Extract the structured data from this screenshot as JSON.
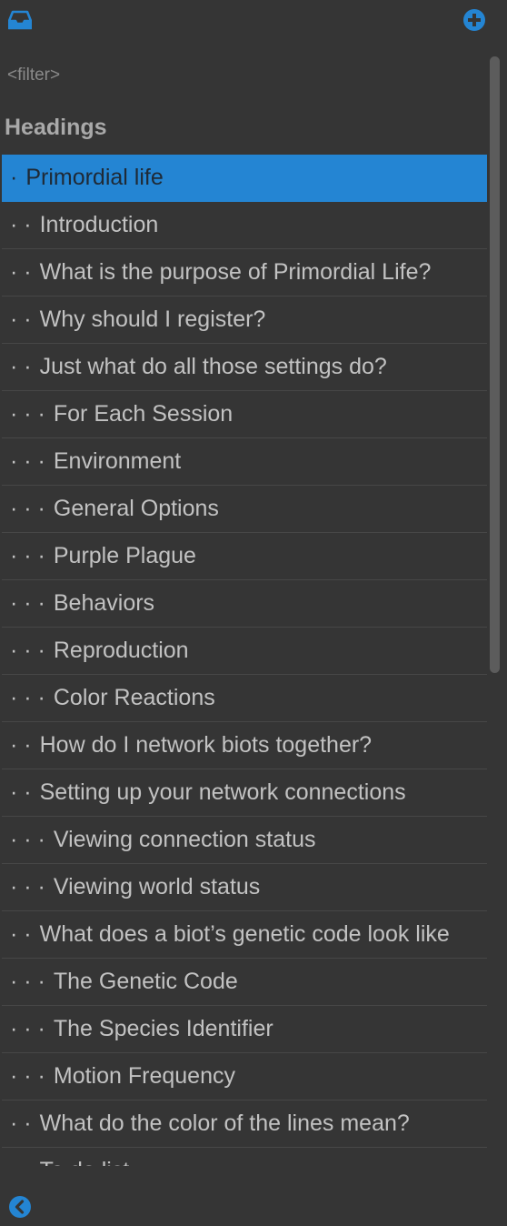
{
  "toolbar": {
    "left_icon": "inbox-tray-icon",
    "right_icon": "plus-circle-icon"
  },
  "filter": {
    "placeholder": "<filter>",
    "value": ""
  },
  "section_title": "Headings",
  "colors": {
    "background": "#353535",
    "accent": "#2485d3",
    "selected_row": "#2485d3",
    "text": "#c2c2c2",
    "divider": "#474747"
  },
  "headings": [
    {
      "dots": "·",
      "label": "Primordial life",
      "selected": true
    },
    {
      "dots": "· ·",
      "label": "Introduction"
    },
    {
      "dots": "· ·",
      "label": "What is the purpose of Primordial Life?"
    },
    {
      "dots": "· ·",
      "label": "Why should I register?"
    },
    {
      "dots": "· ·",
      "label": "Just what do all those settings do?"
    },
    {
      "dots": "· · ·",
      "label": "For Each Session"
    },
    {
      "dots": "· · ·",
      "label": "Environment"
    },
    {
      "dots": "· · ·",
      "label": "General Options"
    },
    {
      "dots": "· · ·",
      "label": "Purple Plague"
    },
    {
      "dots": "· · ·",
      "label": "Behaviors"
    },
    {
      "dots": "· · ·",
      "label": "Reproduction"
    },
    {
      "dots": "· · ·",
      "label": "Color Reactions"
    },
    {
      "dots": "· ·",
      "label": "How do I network biots together?"
    },
    {
      "dots": "· ·",
      "label": "Setting up your network connections"
    },
    {
      "dots": "· · ·",
      "label": "Viewing connection status"
    },
    {
      "dots": "· · ·",
      "label": "Viewing world status"
    },
    {
      "dots": "· ·",
      "label": "What does a biot’s genetic code look like"
    },
    {
      "dots": "· · ·",
      "label": "The Genetic Code"
    },
    {
      "dots": "· · ·",
      "label": "The Species Identifier"
    },
    {
      "dots": "· · ·",
      "label": "Motion Frequency"
    },
    {
      "dots": "· ·",
      "label": "What do the color of the lines mean?"
    },
    {
      "dots": "· ·",
      "label": "To do list"
    }
  ],
  "footer": {
    "back_icon": "chevron-left-circle-icon"
  }
}
